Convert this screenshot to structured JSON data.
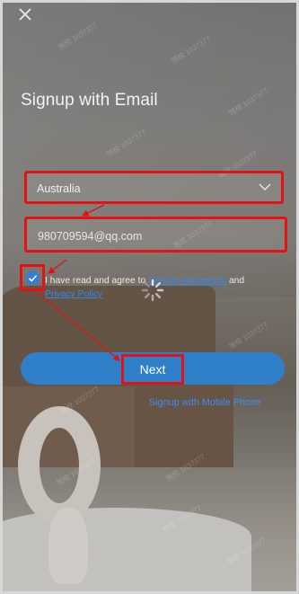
{
  "screen": {
    "title": "Signup with Email",
    "close_icon": "close-icon"
  },
  "form": {
    "country_value": "Australia",
    "email_value": "980709594@qq.com",
    "agreement_prefix": "I have read and agree to ",
    "service_agreement": "Service Agreement",
    "agreement_and": " and",
    "privacy_policy": "Privacy Policy",
    "checkbox_checked": true
  },
  "actions": {
    "next_label": "Next",
    "mobile_signup_label": "Signup with Mobile Phone"
  },
  "watermarks": [
    "驾校 1037377",
    "驾校 1037377",
    "驾校 1037377",
    "驾校 1037377",
    "驾校 1037377",
    "驾校 1037377",
    "驾校 1037377",
    "驾校 1037377",
    "驾校 1037377",
    "驾校 1037377",
    "驾校 1037377",
    "驾校 1037377"
  ],
  "colors": {
    "annotation_red": "#e41212",
    "primary_blue": "#2f7fc9",
    "link_blue": "#2f8bf0"
  }
}
